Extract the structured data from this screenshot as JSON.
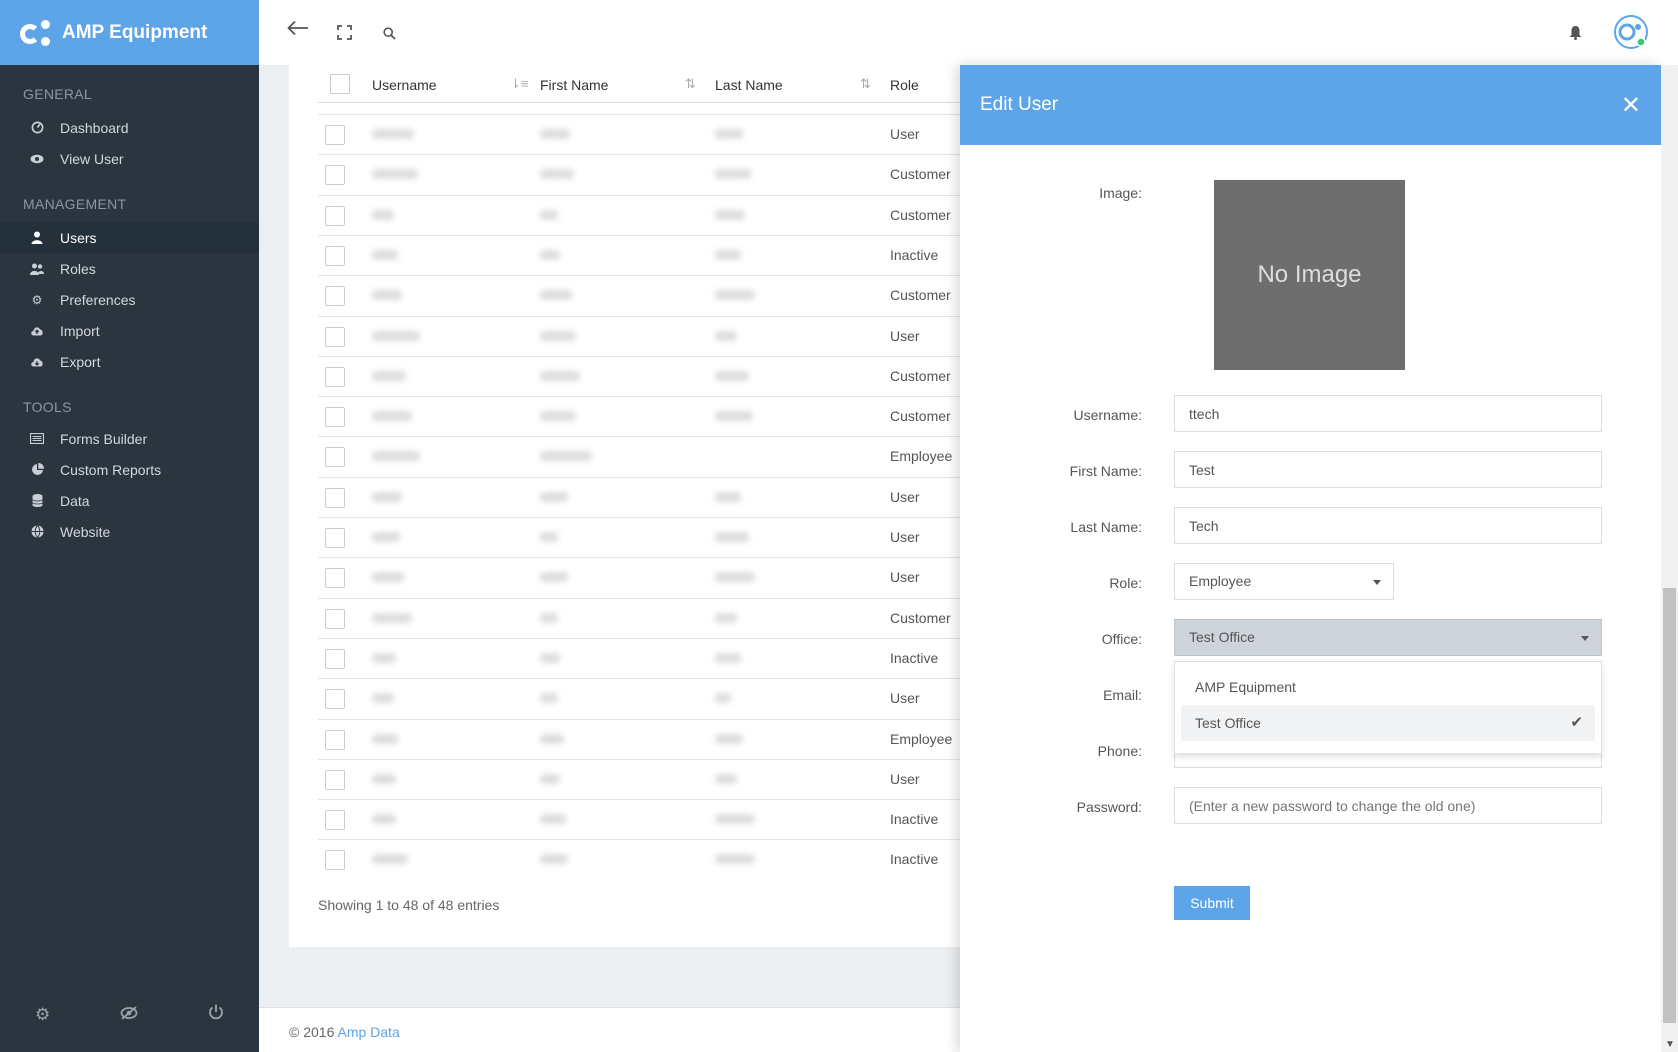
{
  "brand": {
    "name": "AMP Equipment"
  },
  "sidebar": {
    "sections": [
      {
        "title": "GENERAL",
        "items": [
          {
            "label": "Dashboard",
            "icon": "dashboard-icon"
          },
          {
            "label": "View User",
            "icon": "eye-icon"
          }
        ]
      },
      {
        "title": "MANAGEMENT",
        "items": [
          {
            "label": "Users",
            "icon": "user-icon",
            "active": true
          },
          {
            "label": "Roles",
            "icon": "users-icon"
          },
          {
            "label": "Preferences",
            "icon": "gear-icon"
          },
          {
            "label": "Import",
            "icon": "cloud-upload-icon"
          },
          {
            "label": "Export",
            "icon": "cloud-download-icon"
          }
        ]
      },
      {
        "title": "TOOLS",
        "items": [
          {
            "label": "Forms Builder",
            "icon": "list-icon"
          },
          {
            "label": "Custom Reports",
            "icon": "pie-chart-icon"
          },
          {
            "label": "Data",
            "icon": "database-icon"
          },
          {
            "label": "Website",
            "icon": "globe-icon"
          }
        ]
      }
    ],
    "bottom_icons": [
      "gear-icon",
      "eye-slash-icon",
      "power-icon"
    ]
  },
  "table": {
    "headers": [
      "Username",
      "First Name",
      "Last Name",
      "Role"
    ],
    "roles": [
      "User",
      "Customer",
      "Customer",
      "Inactive",
      "Customer",
      "User",
      "Customer",
      "Customer",
      "Employee",
      "User",
      "User",
      "User",
      "Customer",
      "Inactive",
      "User",
      "Employee",
      "User",
      "Inactive",
      "Inactive"
    ],
    "showing": "Showing 1 to 48 of 48 entries"
  },
  "footer": {
    "copyright": "© 2016",
    "link": "Amp Data"
  },
  "modal": {
    "title": "Edit User",
    "labels": {
      "image": "Image:",
      "username": "Username:",
      "first_name": "First Name:",
      "last_name": "Last Name:",
      "role": "Role:",
      "office": "Office:",
      "email": "Email:",
      "phone": "Phone:",
      "password": "Password:"
    },
    "no_image": "No Image",
    "values": {
      "username": "ttech",
      "first_name": "Test",
      "last_name": "Tech",
      "role": "Employee",
      "office": "Test Office"
    },
    "password_placeholder": "(Enter a new password to change the old one)",
    "office_options": [
      {
        "label": "AMP Equipment",
        "selected": false
      },
      {
        "label": "Test Office",
        "selected": true
      }
    ],
    "submit": "Submit"
  }
}
